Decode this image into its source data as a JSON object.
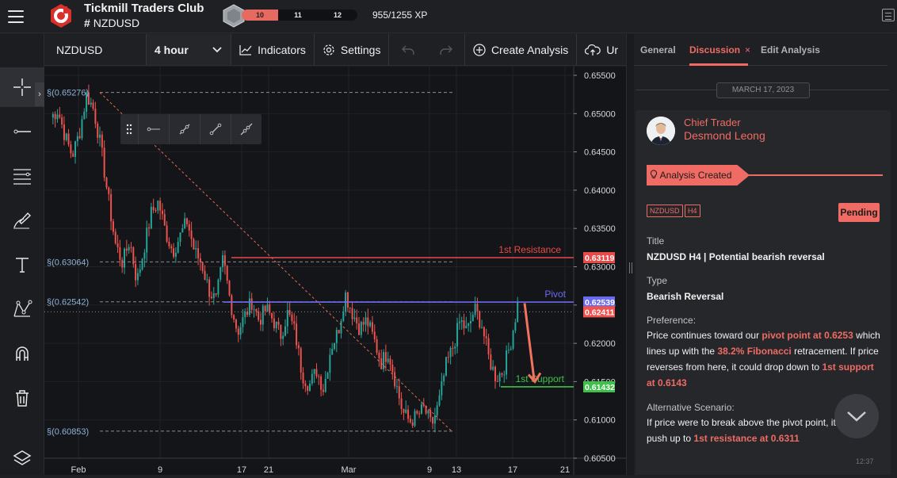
{
  "header": {
    "club_title": "Tickmill Traders Club",
    "channel": "NZDUSD",
    "xp_level_current": "10",
    "xp_level_mid": "11",
    "xp_level_next": "12",
    "xp_text": "955/1255 XP"
  },
  "toolbar": {
    "symbol": "NZDUSD",
    "interval": "4 hour",
    "indicators_label": "Indicators",
    "settings_label": "Settings",
    "create_analysis_label": "Create Analysis",
    "upload_label": "Ur"
  },
  "left_tools": [
    "crosshair-icon",
    "horizontal-line-icon",
    "fib-levels-icon",
    "brush-icon",
    "text-tool-icon",
    "pattern-icon",
    "magnet-icon",
    "trash-icon",
    "layers-icon"
  ],
  "chart_data": {
    "type": "candlestick",
    "symbol": "NZDUSD",
    "interval": "4 hour",
    "ylim": [
      0.605,
      0.655
    ],
    "y_ticks": [
      "0.65500",
      "0.65000",
      "0.64500",
      "0.64000",
      "0.63500",
      "0.63000",
      "0.62500",
      "0.62000",
      "0.61500",
      "0.61000",
      "0.60500"
    ],
    "x_ticks": [
      "Feb",
      "9",
      "17",
      "21",
      "Mar",
      "9",
      "13",
      "17",
      "21"
    ],
    "price_levels": [
      {
        "label": "(0.65276)",
        "value": 0.65276
      },
      {
        "label": "(0.63064)",
        "value": 0.63064
      },
      {
        "label": "(0.62542)",
        "value": 0.62542
      },
      {
        "label": "(0.60853)",
        "value": 0.60853
      }
    ],
    "lines": [
      {
        "name": "1st Resistance",
        "value": 0.63119,
        "tag": "0.63119",
        "color": "#e84a4a"
      },
      {
        "name": "Pivot",
        "value": 0.62539,
        "tag": "0.62539",
        "color": "#6b6bf0"
      },
      {
        "name": "1st Support",
        "value": 0.61432,
        "tag": "0.61432",
        "color": "#3ec14a"
      }
    ],
    "last_price_tag": "0.62411",
    "last_price": 0.62411,
    "close_path": [
      0.6495,
      0.6505,
      0.647,
      0.6445,
      0.6475,
      0.6525,
      0.6505,
      0.6455,
      0.639,
      0.633,
      0.6305,
      0.6335,
      0.628,
      0.6325,
      0.637,
      0.6385,
      0.6345,
      0.632,
      0.634,
      0.636,
      0.632,
      0.6305,
      0.627,
      0.6255,
      0.631,
      0.6255,
      0.6215,
      0.6235,
      0.6255,
      0.623,
      0.6245,
      0.623,
      0.621,
      0.624,
      0.6215,
      0.616,
      0.6145,
      0.6165,
      0.614,
      0.6195,
      0.6215,
      0.6265,
      0.624,
      0.622,
      0.623,
      0.6205,
      0.6175,
      0.619,
      0.615,
      0.611,
      0.6098,
      0.6105,
      0.6115,
      0.6092,
      0.612,
      0.617,
      0.6195,
      0.623,
      0.6215,
      0.6245,
      0.6225,
      0.618,
      0.6155,
      0.6165,
      0.62,
      0.625
    ]
  },
  "panel": {
    "tab_general": "General",
    "tab_discussion": "Discussion",
    "tab_close": "×",
    "tab_edit": "Edit Analysis",
    "date": "MARCH 17, 2023",
    "author_role": "Chief Trader",
    "author_name": "Desmond Leong",
    "status": "Analysis Created",
    "tag_symbol": "NZDUSD",
    "tag_tf": "H4",
    "pending": "Pending",
    "title_label": "Title",
    "title_value": "NZDUSD H4 | Potential bearish reversal",
    "type_label": "Type",
    "type_value": "Bearish Reversal",
    "pref_label": "Preference:",
    "pref_p1": "Price continues toward our ",
    "pref_h1": "pivot point at 0.6253",
    "pref_p2": " which lines up with the ",
    "pref_h2": "38.2% Fibonacci",
    "pref_p3": " retracement. If price reverses from here, it could drop down to ",
    "pref_h3": "1st support at 0.6143",
    "alt_label": "Alternative Scenario:",
    "alt_p1": "If price were to break above the pivot point, it ",
    "alt_p2": "push up to ",
    "alt_h1": "1st resistance at 0.6311",
    "time_stub": "12:37"
  },
  "colors": {
    "accent": "#ef6b63",
    "bull": "#26a69a",
    "bear": "#ef5350",
    "pivot": "#6b6bf0",
    "support": "#3ec14a",
    "resistance": "#e84a4a"
  }
}
